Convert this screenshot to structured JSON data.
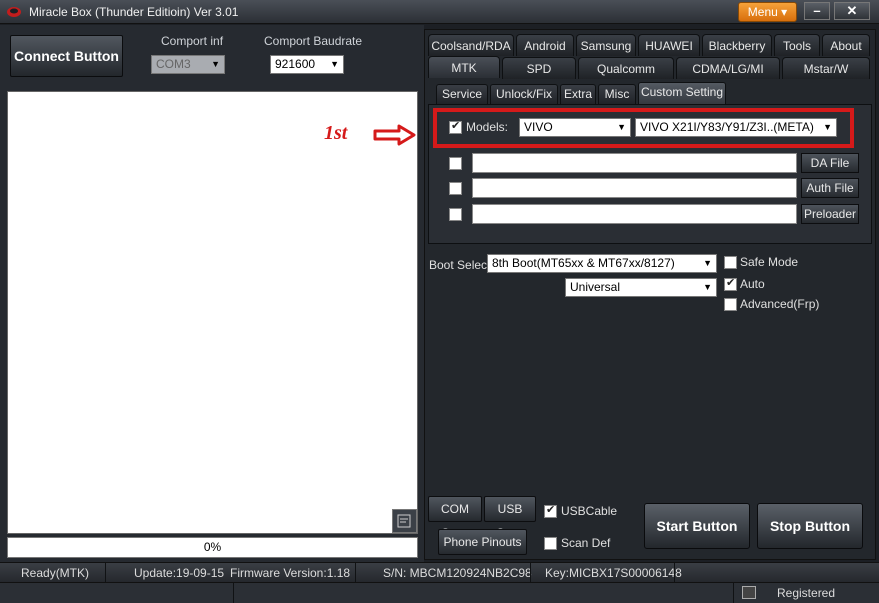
{
  "window": {
    "title": "Miracle Box (Thunder Editioin) Ver 3.01",
    "menu_label": "Menu",
    "minimize_glyph": "–",
    "close_glyph": "✕"
  },
  "left": {
    "connect_label": "Connect Button",
    "comport_label": "Comport inf",
    "comport_value": "COM3",
    "baud_label": "Comport Baudrate",
    "baud_value": "921600",
    "progress_text": "0%"
  },
  "tabs_row1": [
    "Coolsand/RDA",
    "Android",
    "Samsung",
    "HUAWEI",
    "Blackberry",
    "Tools",
    "About"
  ],
  "tabs_row2": [
    "MTK",
    "SPD",
    "Qualcomm",
    "CDMA/LG/MI",
    "Mstar/W"
  ],
  "subtabs": [
    "Service",
    "Unlock/Fix",
    "Extra",
    "Misc",
    "Custom Setting"
  ],
  "custom": {
    "models_label": "Models:",
    "brand_value": "VIVO",
    "model_value": "VIVO X21I/Y83/Y91/Z3I..(META)",
    "da_file_label": "DA File",
    "auth_file_label": "Auth File",
    "preloader_label": "Preloader"
  },
  "boot": {
    "label": "Boot Select:",
    "value": "8th Boot(MT65xx & MT67xx/8127)",
    "mode_value": "Universal",
    "safe_mode_label": "Safe Mode",
    "auto_label": "Auto",
    "advanced_label": "Advanced(Frp)"
  },
  "annotation": {
    "text": "1st",
    "color": "#d51a1a"
  },
  "bottom": {
    "com_scan": "COM Scan",
    "usb_scan": "USB Scan",
    "usb_cable": "USBCable",
    "phone_pinouts": "Phone Pinouts",
    "scan_def": "Scan Def",
    "start": "Start Button",
    "stop": "Stop Button"
  },
  "status": {
    "ready": "Ready(MTK)",
    "update": "Update:19-09-15",
    "firmware": "Firmware Version:1.18",
    "sn": "S/N: MBCM120924NB2C98",
    "key": "Key:MICBX17S00006148",
    "registered": "Registered"
  }
}
